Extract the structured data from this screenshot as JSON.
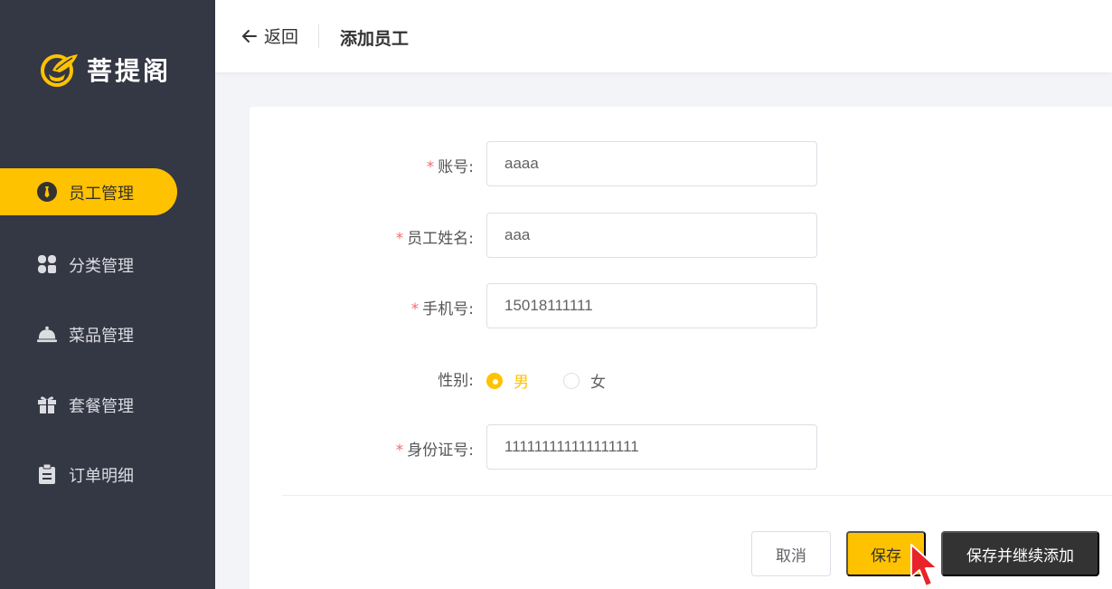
{
  "brand": {
    "name": "菩提阁",
    "logo_icon": "bodhi-logo-icon",
    "accent": "#ffc200"
  },
  "sidebar": {
    "items": [
      {
        "label": "员工管理",
        "icon": "employee-icon",
        "active": true
      },
      {
        "label": "分类管理",
        "icon": "category-grid-icon",
        "active": false
      },
      {
        "label": "菜品管理",
        "icon": "dish-cloche-icon",
        "active": false
      },
      {
        "label": "套餐管理",
        "icon": "gift-package-icon",
        "active": false
      },
      {
        "label": "订单明细",
        "icon": "clipboard-icon",
        "active": false
      }
    ]
  },
  "header": {
    "back_label": "返回",
    "title": "添加员工"
  },
  "form": {
    "account": {
      "label": "账号:",
      "required": "*",
      "value": "aaaa"
    },
    "name": {
      "label": "员工姓名:",
      "required": "*",
      "value": "aaa"
    },
    "phone": {
      "label": "手机号:",
      "required": "*",
      "value": "15018111111"
    },
    "gender": {
      "label": "性别:",
      "options": [
        "男",
        "女"
      ],
      "selected": "男"
    },
    "id_number": {
      "label": "身份证号:",
      "required": "*",
      "value": "111111111111111111"
    }
  },
  "actions": {
    "cancel": "取消",
    "save": "保存",
    "save_continue": "保存并继续添加"
  }
}
